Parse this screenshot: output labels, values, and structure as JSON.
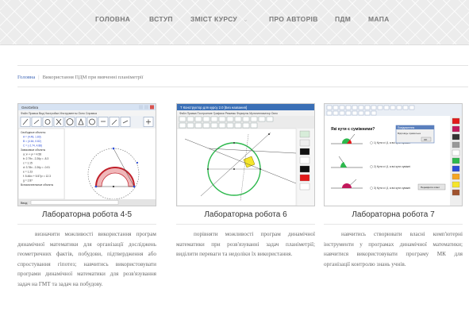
{
  "nav": {
    "items": [
      {
        "label": "ГОЛОВНА"
      },
      {
        "label": "ВСТУП"
      },
      {
        "label": "ЗМІСТ КУРСУ"
      },
      {
        "label": "ПРО АВТОРІВ"
      },
      {
        "label": "ПДМ"
      },
      {
        "label": "МАПА"
      }
    ],
    "caret": "⌄"
  },
  "breadcrumb": {
    "home": "Головна",
    "separator": "|",
    "current": "Використання ПДМ при вивченні планіметрії"
  },
  "cards": [
    {
      "title": "Лабораторна робота 4-5",
      "description": "визначити можливості використання програм динамічної математики для організації досліджень геометричних фактів, побудови, підтвердження або спростування гіпотез; навчитись використовувати програми динамічної математики для розв'язування задач на ГМТ та задач на побудову.",
      "thumbnail": "GeoGebra window: algebra view with coordinates and geometry view with circle construction"
    },
    {
      "title": "Лабораторна робота 6",
      "description": "порівняти можливості програм динамічної математики при розв'язуванні задач планіметрії; виділити переваги та недоліки їх використання.",
      "thumbnail": "Dynamic geometry window: green circle with intersecting lines and yellow square"
    },
    {
      "title": "Лабораторна робота 7",
      "description": "навчитись створювати власні комп'ютерні інструменти у програмах динамічної математики; навчитися використовувати програму МК для організації контролю знань учнів.",
      "thumbnail": "Test window: «Які кути є суміжними?» with answer options and a message dialog"
    }
  ],
  "thumb_texts": {
    "geogebra_title": "GeoGebra",
    "geogebra_menu": "Файл Правка Вид Настройки Инструменты Окно Справка",
    "geogebra_algebra": [
      "Свободные объекты",
      "A = (4.48, 1.83)",
      "B = (4.64, 0.82)",
      "C = (-2.74, 4.88)",
      "Зависимые объекты",
      "a: x² + y² = 4.58",
      "b: 2.79x - 2.26y = -8.3",
      "c = 1.15",
      "d: 3.78x - 2.26y = -0.01",
      "e = 1.23",
      "f: 5.46x² + 5.57y² = 12.3",
      "g = 2.87",
      "Вспомогательные объекты"
    ],
    "geogebra_input": "Ввод:",
    "gs_title": "Т Конструктор для курсу 2.0 [Без названия]",
    "gs_menu": "Файл Правка Построение Графики Режимы Формулы Мультипликатор Окно",
    "test_question": "Які кути є суміжними?",
    "test_options": [
      "1) Кути α і β, а всі кути суміжні",
      "2) Кути α і β, а всі кути суміжні",
      "3) Кути α і β, а всі кути суміжні"
    ],
    "test_dialog_title": "Повідомлення",
    "test_dialog_text": "Відповідь правильна",
    "test_dialog_ok": "OK",
    "test_next": "Перевірити ответ"
  },
  "colors": {
    "nav_text": "#7a7a7a",
    "link": "#3b63b5",
    "text": "#6a6a6a",
    "title": "#333333",
    "circle_green": "#2db84d",
    "arc_red": "#c0202a"
  }
}
